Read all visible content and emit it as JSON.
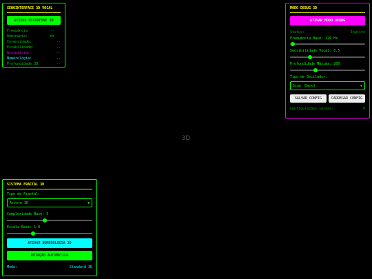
{
  "interface": {
    "title": "XENOINTERFACE 3D VOCAL",
    "mic_button": "ATIVAR MICROFONE 3D",
    "rows": [
      {
        "label": "Frequência Dominante:",
        "value": "-- Hz",
        "color": "#00cc00"
      },
      {
        "label": "Intensidade:",
        "value": "--",
        "color": "#00cc00"
      },
      {
        "label": "Estabilidade:",
        "value": "--",
        "color": "#00cc00"
      },
      {
        "label": "Assinatura:",
        "value": "--",
        "color": "#ff00ff"
      },
      {
        "label": "Numerologia:",
        "value": "--",
        "color": "#00ffff"
      },
      {
        "label": "Profundidade 3D:",
        "value": "--",
        "color": "#00cc00"
      }
    ]
  },
  "debug": {
    "title": "MODO DEBUG 3D",
    "toggle_button": "ATIVAR MODO DEBUG",
    "status_label": "Status:",
    "status_value": "Inativo",
    "freq_label": "Frequência Base: 220 Hz",
    "freq_level": 0.04,
    "sens_label": "Sensibilidade Vocal: 0.5",
    "sens_level": 0.27,
    "depth_label": "Profundidade Máxima: 200",
    "depth_level": 0.34,
    "osc_label": "Tipo de Oscilador:",
    "osc_value": "Sine (Seno)",
    "save_button": "SALVAR CONFIG",
    "load_button": "CARREGAR CONFIG",
    "saved_label": "Configurações salvas:",
    "saved_value": "0"
  },
  "center_label": "3D",
  "fractal": {
    "title": "SISTEMA FRACTAL 3D",
    "type_label": "Tipo de Fractal:",
    "type_value": "Árvore 3D",
    "complexity_label": "Complexidade Base: 5",
    "complexity_level": 0.44,
    "scale_label": "Escala Base: 1.0",
    "scale_level": 0.31,
    "numerology_button": "ATIVAR NUMEROLOGIA 3D",
    "rotation_button": "ROTAÇÃO AUTOMÁTICA",
    "mode_label": "Modo:",
    "mode_value": "Standard 3D"
  }
}
